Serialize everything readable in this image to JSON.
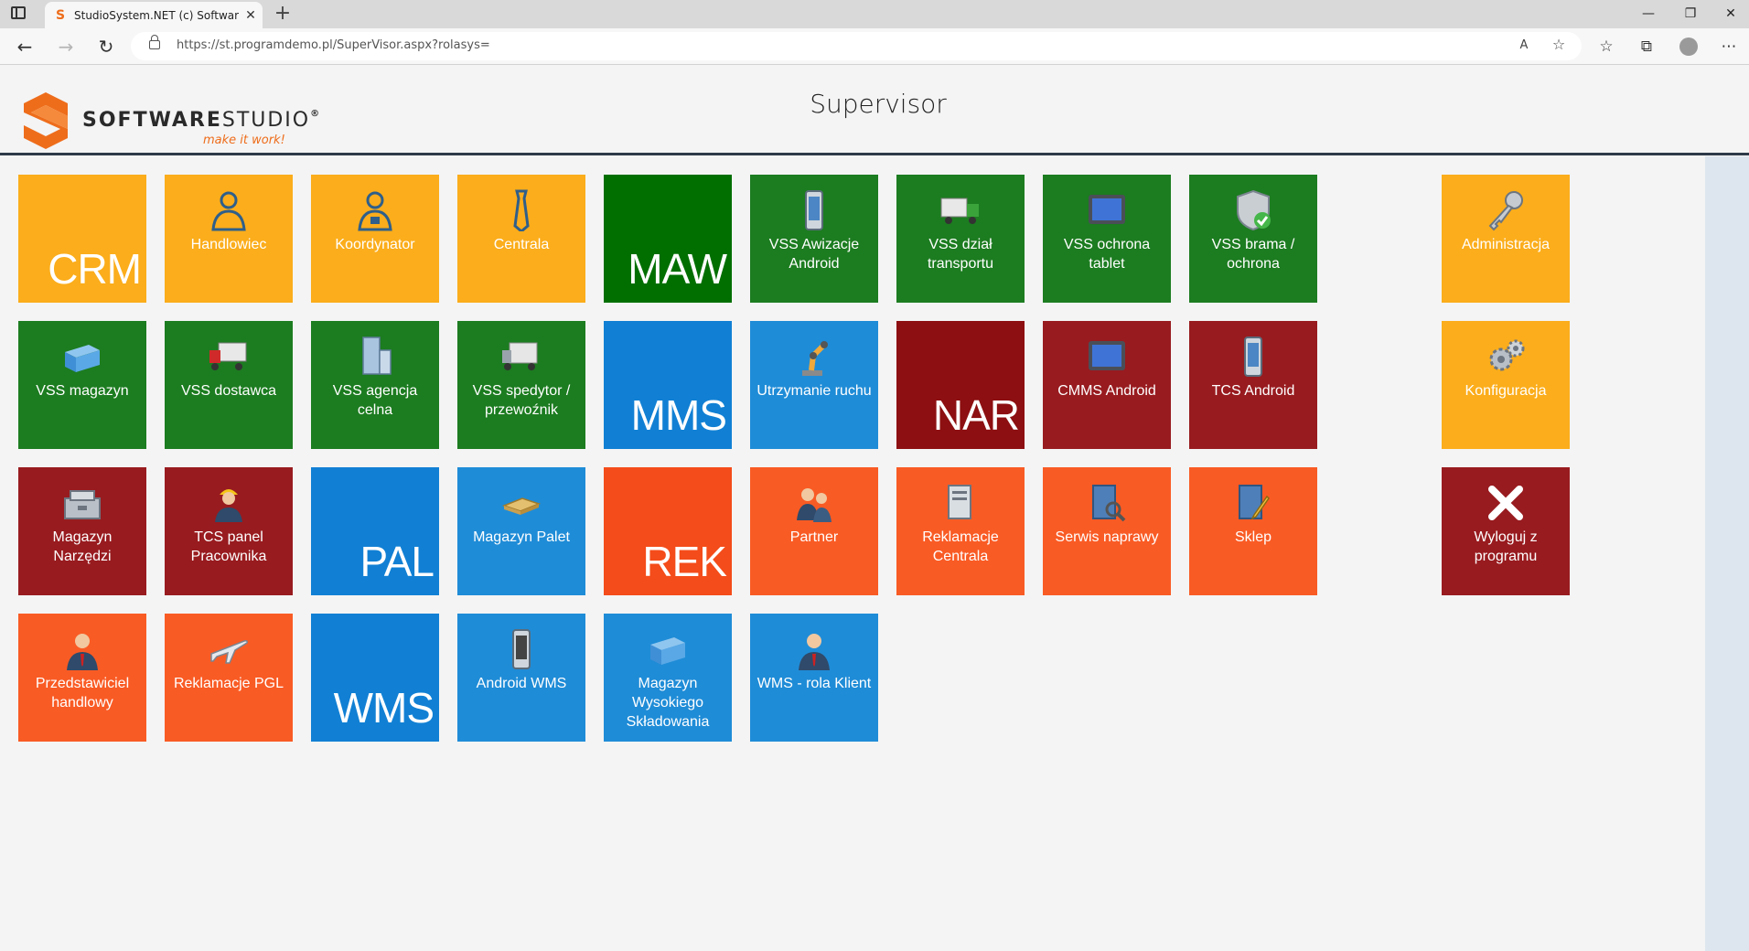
{
  "browser": {
    "tab_title": "StudioSystem.NET (c) SoftwareSt",
    "tab_close": "✕",
    "new_tab": "+",
    "url": "https://st.programdemo.pl/SuperVisor.aspx?rolasys=",
    "window_minimize": "—",
    "window_restore": "❐",
    "window_close": "✕",
    "back": "←",
    "forward": "→",
    "reload": "↻",
    "read_aloud": "A",
    "add_favorite": "☆",
    "favorites": "☆",
    "collections": "⧉",
    "more": "⋯"
  },
  "header": {
    "brand_bold": "SOFTWARE",
    "brand_light": "STUDIO",
    "brand_reg": "®",
    "tagline": "make it work!",
    "title": "Supervisor"
  },
  "tiles": {
    "crm": "CRM",
    "handlowiec": "Handlowiec",
    "koordynator": "Koordynator",
    "centrala": "Centrala",
    "maw": "MAW",
    "vss_awizacje": "VSS Awizacje Android",
    "vss_transport": "VSS dział transportu",
    "vss_ochrona_tablet": "VSS ochrona tablet",
    "vss_brama": "VSS brama / ochrona",
    "administracja": "Administracja",
    "vss_magazyn": "VSS magazyn",
    "vss_dostawca": "VSS dostawca",
    "vss_agencja": "VSS agencja celna",
    "vss_spedytor": "VSS spedytor / przewoźnik",
    "mms": "MMS",
    "utrzymanie": "Utrzymanie ruchu",
    "nar": "NAR",
    "cmms_android": "CMMS Android",
    "tcs_android": "TCS Android",
    "konfiguracja": "Konfiguracja",
    "magazyn_narzedzi": "Magazyn Narzędzi",
    "tcs_panel": "TCS panel Pracownika",
    "pal": "PAL",
    "magazyn_palet": "Magazyn Palet",
    "rek": "REK",
    "partner": "Partner",
    "reklamacje_centrala": "Reklamacje Centrala",
    "serwis": "Serwis naprawy",
    "sklep": "Sklep",
    "wyloguj": "Wyloguj z programu",
    "przedstawiciel": "Przedstawiciel handlowy",
    "reklamacje_pgl": "Reklamacje PGL",
    "wms": "WMS",
    "android_wms": "Android WMS",
    "mws": "Magazyn Wysokiego Składowania",
    "wms_klient": "WMS - rola Klient"
  },
  "colors": {
    "orange": "#fbad1b",
    "dark_green": "#006f00",
    "green": "#1c7c20",
    "blue": "#1180d4",
    "dark_red": "#981b1f",
    "orange_red": "#f95b24",
    "header_rule": "#2d3a48",
    "logo_orange": "#ee6d1b"
  }
}
